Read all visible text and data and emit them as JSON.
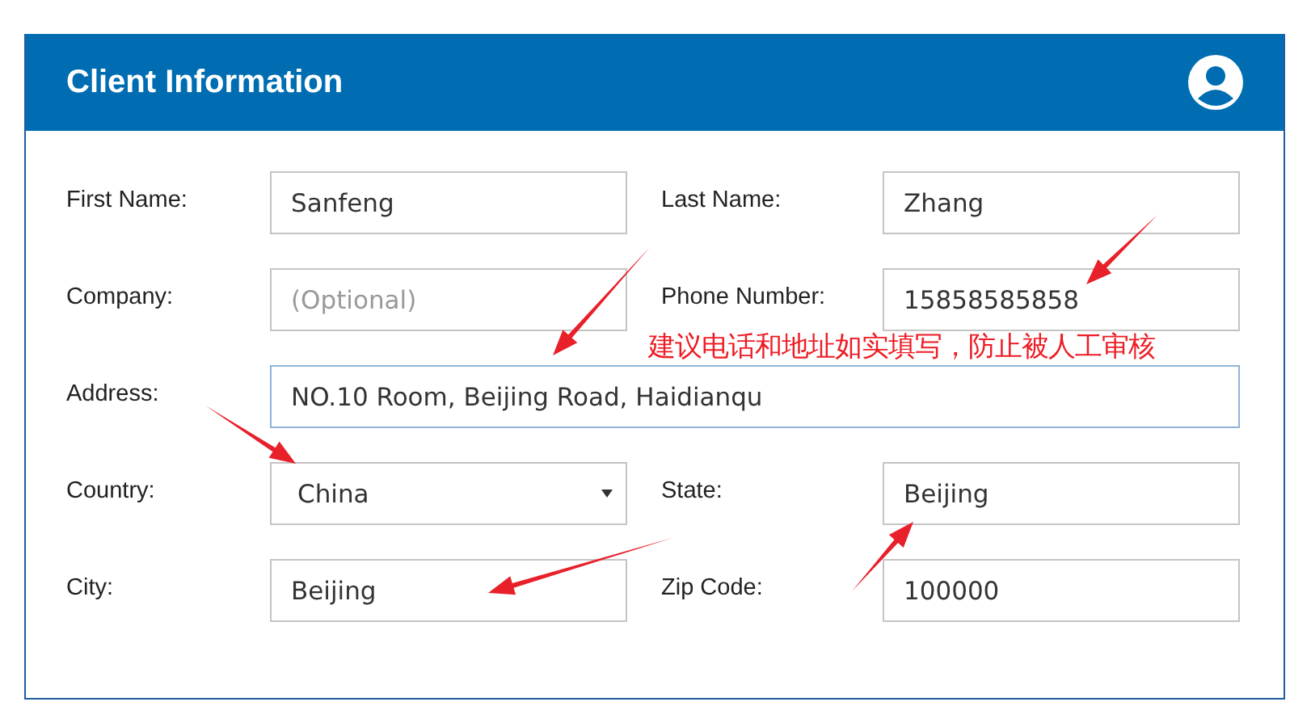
{
  "panel": {
    "title": "Client Information"
  },
  "fields": [
    {
      "kind": "text",
      "label": "First Name:",
      "value": "Sanfeng",
      "wide": false,
      "focused": false
    },
    {
      "kind": "text",
      "label": "Last Name:",
      "value": "Zhang",
      "wide": false,
      "focused": false
    },
    {
      "kind": "text",
      "label": "Company:",
      "placeholder": "(Optional)",
      "wide": false,
      "focused": false
    },
    {
      "kind": "text",
      "label": "Phone Number:",
      "value": "15858585858",
      "wide": false,
      "focused": false
    },
    {
      "kind": "text",
      "label": "Address:",
      "value": "NO.10 Room, Beijing Road, Haidianqu",
      "wide": true,
      "focused": true
    },
    {
      "kind": "select",
      "label": "Country:",
      "value": "China",
      "wide": false,
      "focused": false
    },
    {
      "kind": "text",
      "label": "State:",
      "value": "Beijing",
      "wide": false,
      "focused": false
    },
    {
      "kind": "text",
      "label": "City:",
      "value": "Beijing",
      "wide": false,
      "focused": false
    },
    {
      "kind": "text",
      "label": "Zip Code:",
      "value": "100000",
      "wide": false,
      "focused": false
    }
  ],
  "annotation": {
    "note": "建议电话和地址如实填写，防止被人工审核"
  }
}
